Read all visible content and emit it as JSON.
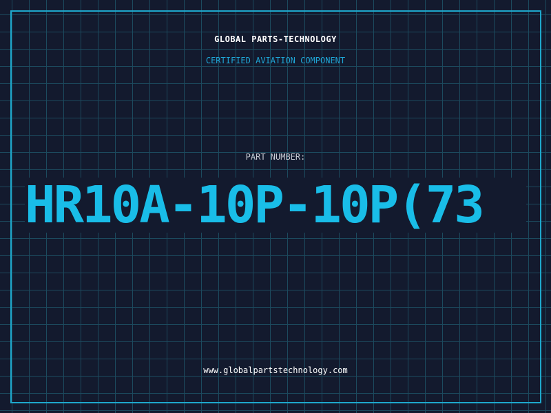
{
  "header": {
    "brand": "GLOBAL PARTS-TECHNOLOGY",
    "subtitle": "CERTIFIED AVIATION COMPONENT"
  },
  "part": {
    "label": "PART NUMBER:",
    "number": "HR10A-10P-10P(73"
  },
  "footer": {
    "url": "www.globalpartstechnology.com"
  },
  "colors": {
    "background": "#131a2e",
    "grid": "#1c4a5e",
    "accent": "#1ea8cc",
    "part_number": "#19bde8"
  }
}
